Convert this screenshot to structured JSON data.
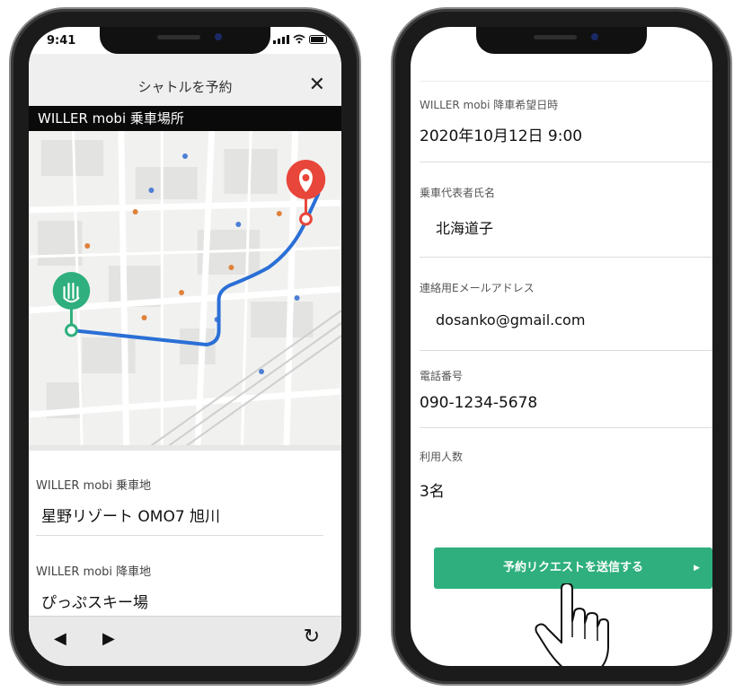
{
  "left_phone": {
    "status_time": "9:41",
    "header_title": "シャトルを予約",
    "close_label": "✕",
    "section_title": "WILLER mobi 乗車場所",
    "pickup_label": "WILLER mobi 乗車地",
    "pickup_value": "星野リゾート OMO7 旭川",
    "dropoff_label": "WILLER mobi 降車地",
    "dropoff_value": "ぴっぷスキー場",
    "nav_back": "◀",
    "nav_forward": "▶",
    "nav_refresh": "↻",
    "route_color": "#2a6fd6",
    "start_pin_color": "#2eaf7d",
    "end_pin_color": "#e8463a"
  },
  "right_phone": {
    "fields": [
      {
        "label": "WILLER mobi 降車希望日時",
        "value": "2020年10月12日 9:00"
      },
      {
        "label": "乗車代表者氏名",
        "value": "北海道子"
      },
      {
        "label": "連絡用Eメールアドレス",
        "value": "dosanko@gmail.com"
      },
      {
        "label": "電話番号",
        "value": "090-1234-5678"
      },
      {
        "label": "利用人数",
        "value": "3名"
      }
    ],
    "submit_label": "予約リクエストを送信する",
    "submit_arrow": "▶",
    "accent_color": "#2eaf7d"
  }
}
